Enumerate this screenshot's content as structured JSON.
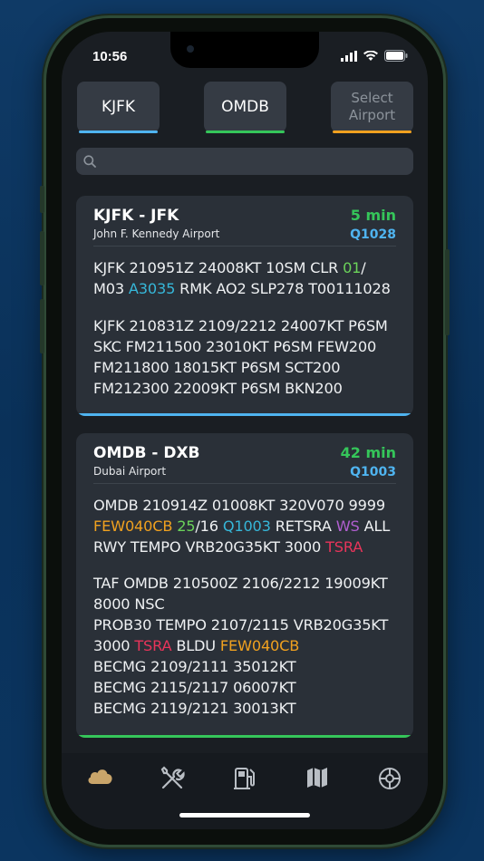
{
  "status": {
    "time": "10:56"
  },
  "airports": [
    {
      "label": "KJFK",
      "accent": "#4fb4f0"
    },
    {
      "label": "OMDB",
      "accent": "#35c65a"
    },
    {
      "label_line1": "Select",
      "label_line2": "Airport",
      "accent": "#f0a11f"
    }
  ],
  "search": {
    "placeholder": ""
  },
  "cards": [
    {
      "code": "KJFK  -  JFK",
      "name": "John F. Kennedy Airport",
      "age": "5 min",
      "qnh": "Q1028",
      "accent": "#4fb4f0",
      "metar": {
        "l1a": "KJFK 210951Z 24008KT 10SM CLR ",
        "l1b": "01",
        "l1c": "/",
        "l2a": "M03 ",
        "l2b": "A3035",
        "l2c": " RMK AO2 SLP278 T00111028"
      },
      "taf": [
        "KJFK 210831Z 2109/2212 24007KT P6SM",
        "SKC FM211500 23010KT P6SM FEW200",
        "FM211800 18015KT P6SM SCT200",
        "FM212300 22009KT P6SM BKN200"
      ]
    },
    {
      "code": "OMDB  -  DXB",
      "name": "Dubai Airport",
      "age": "42 min",
      "qnh": "Q1003",
      "accent": "#35c65a",
      "metar": {
        "l1": "OMDB 210914Z 01008KT 320V070 9999",
        "l2a": "FEW040CB",
        "l2b": " ",
        "l2c": "25",
        "l2d": "/16 ",
        "l2e": "Q1003",
        "l2f": " RETSRA ",
        "l2g": "WS",
        "l2h": " ALL",
        "l3a": "RWY TEMPO VRB20G35KT 3000 ",
        "l3b": "TSRA"
      },
      "taf": {
        "l1": "TAF OMDB 210500Z 2106/2212 19009KT",
        "l2": "8000 NSC",
        "l3": "PROB30 TEMPO 2107/2115 VRB20G35KT",
        "l4a": "3000 ",
        "l4b": "TSRA",
        "l4c": " BLDU ",
        "l4d": "FEW040CB",
        "l5": "BECMG 2109/2111 35012KT",
        "l6": "BECMG 2115/2117 06007KT",
        "l7": "BECMG 2119/2121 30013KT"
      }
    }
  ],
  "tabs": [
    {
      "icon": "cloud-icon",
      "active": true
    },
    {
      "icon": "tools-icon",
      "active": false
    },
    {
      "icon": "fuel-icon",
      "active": false
    },
    {
      "icon": "map-icon",
      "active": false
    },
    {
      "icon": "settings-icon",
      "active": false
    }
  ]
}
